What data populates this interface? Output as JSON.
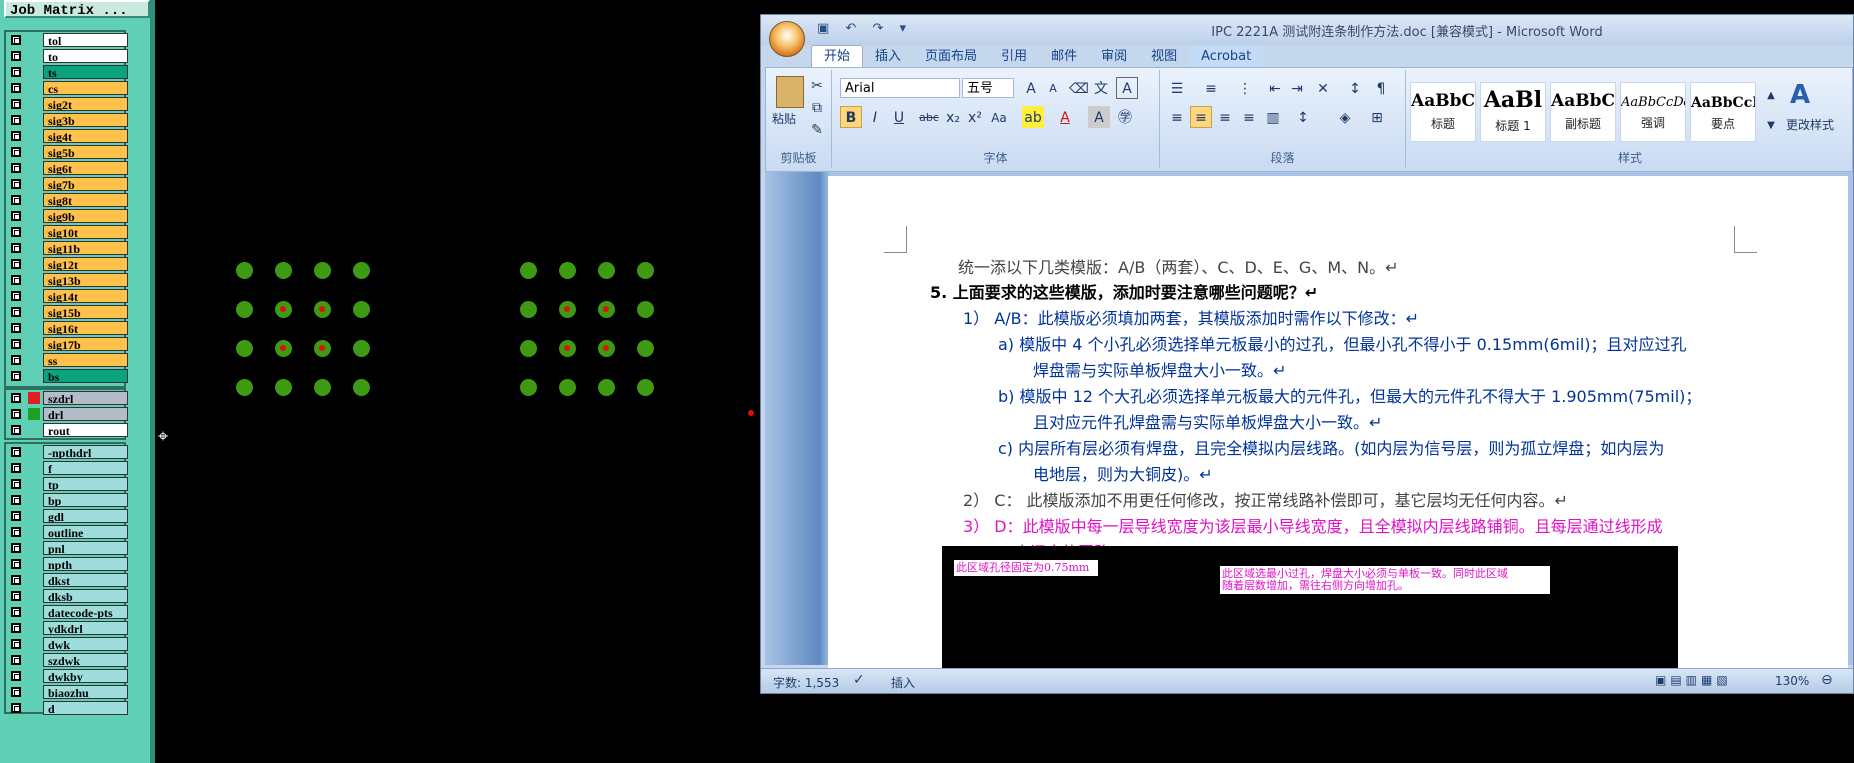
{
  "job_matrix": {
    "title": "Job Matrix ...",
    "group1": [
      {
        "name": "tol",
        "color": "#ffffff"
      },
      {
        "name": "to",
        "color": "#ffffff"
      },
      {
        "name": "ts",
        "color": "#0aa37d"
      },
      {
        "name": "cs",
        "color": "#ffc04c"
      },
      {
        "name": "sig2t",
        "color": "#ffc04c"
      },
      {
        "name": "sig3b",
        "color": "#ffc04c"
      },
      {
        "name": "sig4t",
        "color": "#ffc04c"
      },
      {
        "name": "sig5b",
        "color": "#ffc04c"
      },
      {
        "name": "sig6t",
        "color": "#ffc04c"
      },
      {
        "name": "sig7b",
        "color": "#ffc04c"
      },
      {
        "name": "sig8t",
        "color": "#ffc04c"
      },
      {
        "name": "sig9b",
        "color": "#ffc04c"
      },
      {
        "name": "sig10t",
        "color": "#ffc04c"
      },
      {
        "name": "sig11b",
        "color": "#ffc04c"
      },
      {
        "name": "sig12t",
        "color": "#ffc04c"
      },
      {
        "name": "sig13b",
        "color": "#ffc04c"
      },
      {
        "name": "sig14t",
        "color": "#ffc04c"
      },
      {
        "name": "sig15b",
        "color": "#ffc04c"
      },
      {
        "name": "sig16t",
        "color": "#ffc04c"
      },
      {
        "name": "sig17b",
        "color": "#ffc04c"
      },
      {
        "name": "ss",
        "color": "#ffc04c"
      },
      {
        "name": "bs",
        "color": "#0aa37d"
      }
    ],
    "group2": [
      {
        "name": "szdrl",
        "color": "#b5bcc9",
        "swatch": "#e02020"
      },
      {
        "name": "drl",
        "color": "#b5bcc9",
        "swatch": "#20a020"
      },
      {
        "name": "rout",
        "color": "#ffffff",
        "swatch": ""
      }
    ],
    "group3": [
      {
        "name": "-npthdrl",
        "color": "#9fdcdc"
      },
      {
        "name": "f",
        "color": "#9fdcdc"
      },
      {
        "name": "tp",
        "color": "#9fdcdc"
      },
      {
        "name": "bp",
        "color": "#9fdcdc"
      },
      {
        "name": "gdl",
        "color": "#9fdcdc"
      },
      {
        "name": "outline",
        "color": "#9fdcdc"
      },
      {
        "name": "pnl",
        "color": "#9fdcdc"
      },
      {
        "name": "npth",
        "color": "#9fdcdc"
      },
      {
        "name": "dkst",
        "color": "#9fdcdc"
      },
      {
        "name": "dksb",
        "color": "#9fdcdc"
      },
      {
        "name": "datecode-pts",
        "color": "#9fdcdc"
      },
      {
        "name": "ydkdrl",
        "color": "#9fdcdc"
      },
      {
        "name": "dwk",
        "color": "#9fdcdc"
      },
      {
        "name": "szdwk",
        "color": "#9fdcdc"
      },
      {
        "name": "dwkby",
        "color": "#9fdcdc"
      },
      {
        "name": "biaozhu",
        "color": "#9fdcdc"
      },
      {
        "name": "d",
        "color": "#9fdcdc"
      }
    ]
  },
  "word": {
    "title": "IPC 2221A 测试附连条制作方法.doc [兼容模式] - Microsoft Word",
    "tabs": [
      "开始",
      "插入",
      "页面布局",
      "引用",
      "邮件",
      "审阅",
      "视图",
      "Acrobat"
    ],
    "clipboard": {
      "paste": "粘贴",
      "label": "剪贴板"
    },
    "font": {
      "name": "Arial",
      "size": "五号",
      "label": "字体"
    },
    "paragraph_label": "段落",
    "styles_label": "样式",
    "change_styles": "更改样式",
    "styles": [
      {
        "sample": "AaBbC",
        "name": "标题"
      },
      {
        "sample": "AaBl",
        "name": "标题 1"
      },
      {
        "sample": "AaBbC",
        "name": "副标题"
      },
      {
        "sample": "AaBbCcDd",
        "name": "强调"
      },
      {
        "sample": "AaBbCcD",
        "name": "要点"
      }
    ],
    "doc": {
      "l1": "统一添以下几类模版：A/B（两套）、C、D、E、G、M、N。↵",
      "l2": "5.   上面要求的这些模版，添加时要注意哪些问题呢？↵",
      "l3": "1）  A/B：此模版必须填加两套，其模版添加时需作以下修改：↵",
      "l4": "a)   模版中 4 个小孔必须选择单元板最小的过孔，但最小孔不得小于 0.15mm(6mil)；且对应过孔",
      "l5": "焊盘需与实际单板焊盘大小一致。↵",
      "l6": "b)   模版中 12 个大孔必须选择单元板最大的元件孔，但最大的元件孔不得大于 1.905mm(75mil)；",
      "l7": "且对应元件孔焊盘需与实际单板焊盘大小一致。↵",
      "l8": "c)   内层所有层必须有焊盘，且完全模拟内层线路。(如内层为信号层，则为孤立焊盘；如内层为",
      "l9": "电地层，则为大铜皮)。↵",
      "l10": "2）  C：    此模版添加不用更任何修改，按正常线路补偿即可，基它层均无任何内容。↵",
      "l11": "3）  D：此模版中每一层导线宽度为该层最小导线宽度，且全模拟内层线路铺铜。且每层通过线形成",
      "l12": "一个闭合的回路。↵",
      "img_label1": "此区域孔径固定为0.75mm",
      "img_label2a": "此区域选最小过孔，焊盘大小必须与单板一致。同时此区域",
      "img_label2b": "随着层数增加，需往右侧方向增加孔。"
    },
    "status": {
      "words": "字数: 1,553",
      "mode": "插入",
      "zoom": "130%"
    }
  },
  "colors": {
    "pad": "#3d9a12",
    "hole": "#e01010"
  }
}
